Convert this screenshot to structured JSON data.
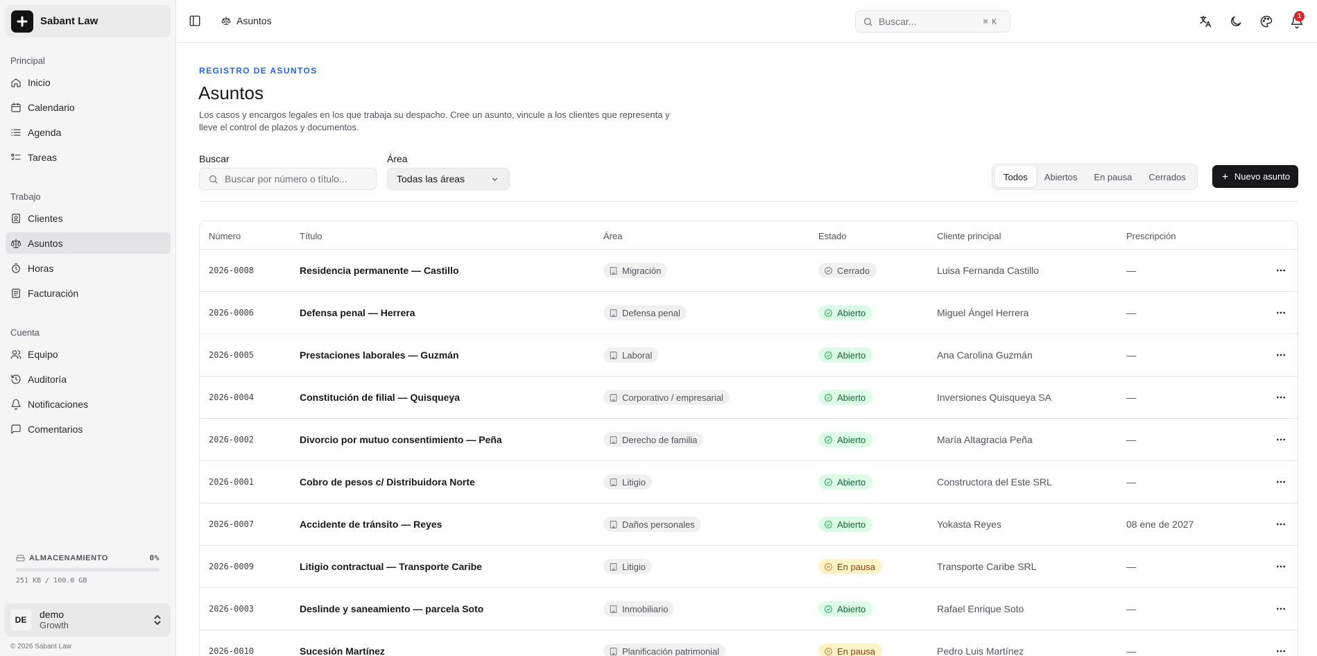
{
  "brand": {
    "name": "Sabant Law"
  },
  "sidebar": {
    "sections": [
      {
        "label": "Principal",
        "items": [
          {
            "label": "Inicio",
            "icon": "home-icon"
          },
          {
            "label": "Calendario",
            "icon": "calendar-icon"
          },
          {
            "label": "Agenda",
            "icon": "list-icon"
          },
          {
            "label": "Tareas",
            "icon": "tasks-icon"
          }
        ]
      },
      {
        "label": "Trabajo",
        "items": [
          {
            "label": "Clientes",
            "icon": "contact-icon"
          },
          {
            "label": "Asuntos",
            "icon": "scale-icon",
            "active": true
          },
          {
            "label": "Horas",
            "icon": "timer-icon"
          },
          {
            "label": "Facturación",
            "icon": "invoice-icon"
          }
        ]
      },
      {
        "label": "Cuenta",
        "items": [
          {
            "label": "Equipo",
            "icon": "users-icon"
          },
          {
            "label": "Auditoría",
            "icon": "history-icon"
          },
          {
            "label": "Notificaciones",
            "icon": "bell-icon"
          },
          {
            "label": "Comentarios",
            "icon": "message-icon"
          }
        ]
      }
    ],
    "storage": {
      "label": "ALMACENAMIENTO",
      "percent_text": "0%",
      "fraction": 0.0,
      "usage_text": "251 KB / 100.0 GB"
    },
    "user": {
      "initials": "DE",
      "name": "demo",
      "plan": "Growth"
    },
    "copyright": "© 2026 Sabant Law"
  },
  "header": {
    "breadcrumb": "Asuntos",
    "search_placeholder": "Buscar...",
    "search_shortcut": "⌘K",
    "notification_count": "1"
  },
  "page": {
    "eyebrow": "REGISTRO DE ASUNTOS",
    "title": "Asuntos",
    "description": "Los casos y encargos legales en los que trabaja su despacho. Cree un asunto, vincule a los clientes que representa y lleve el control de plazos y documentos."
  },
  "filters": {
    "search_label": "Buscar",
    "search_placeholder": "Buscar por número o título...",
    "area_label": "Área",
    "area_value": "Todas las áreas",
    "tabs": [
      "Todos",
      "Abiertos",
      "En pausa",
      "Cerrados"
    ],
    "active_tab": 0,
    "new_button": "Nuevo asunto"
  },
  "table": {
    "columns": [
      "Número",
      "Título",
      "Área",
      "Estado",
      "Cliente principal",
      "Prescripción"
    ],
    "rows": [
      {
        "number": "2026-0008",
        "title": "Residencia permanente — Castillo",
        "area": "Migración",
        "status": "Cerrado",
        "status_kind": "closed",
        "client": "Luisa Fernanda Castillo",
        "prescription": "—"
      },
      {
        "number": "2026-0006",
        "title": "Defensa penal — Herrera",
        "area": "Defensa penal",
        "status": "Abierto",
        "status_kind": "open",
        "client": "Miguel Ángel Herrera",
        "prescription": "—"
      },
      {
        "number": "2026-0005",
        "title": "Prestaciones laborales — Guzmán",
        "area": "Laboral",
        "status": "Abierto",
        "status_kind": "open",
        "client": "Ana Carolina Guzmán",
        "prescription": "—"
      },
      {
        "number": "2026-0004",
        "title": "Constitución de filial — Quisqueya",
        "area": "Corporativo / empresarial",
        "status": "Abierto",
        "status_kind": "open",
        "client": "Inversiones Quisqueya SA",
        "prescription": "—"
      },
      {
        "number": "2026-0002",
        "title": "Divorcio por mutuo consentimiento — Peña",
        "area": "Derecho de familia",
        "status": "Abierto",
        "status_kind": "open",
        "client": "María Altagracia Peña",
        "prescription": "—"
      },
      {
        "number": "2026-0001",
        "title": "Cobro de pesos c/ Distribuidora Norte",
        "area": "Litigio",
        "status": "Abierto",
        "status_kind": "open",
        "client": "Constructora del Este SRL",
        "prescription": "—"
      },
      {
        "number": "2026-0007",
        "title": "Accidente de tránsito — Reyes",
        "area": "Daños personales",
        "status": "Abierto",
        "status_kind": "open",
        "client": "Yokasta Reyes",
        "prescription": "08 ene de 2027"
      },
      {
        "number": "2026-0009",
        "title": "Litigio contractual — Transporte Caribe",
        "area": "Litigio",
        "status": "En pausa",
        "status_kind": "paused",
        "client": "Transporte Caribe SRL",
        "prescription": "—"
      },
      {
        "number": "2026-0003",
        "title": "Deslinde y saneamiento — parcela Soto",
        "area": "Inmobiliario",
        "status": "Abierto",
        "status_kind": "open",
        "client": "Rafael Enrique Soto",
        "prescription": "—"
      },
      {
        "number": "2026-0010",
        "title": "Sucesión Martínez",
        "area": "Planificación patrimonial",
        "status": "En pausa",
        "status_kind": "paused",
        "client": "Pedro Luis Martínez",
        "prescription": "—"
      }
    ]
  }
}
